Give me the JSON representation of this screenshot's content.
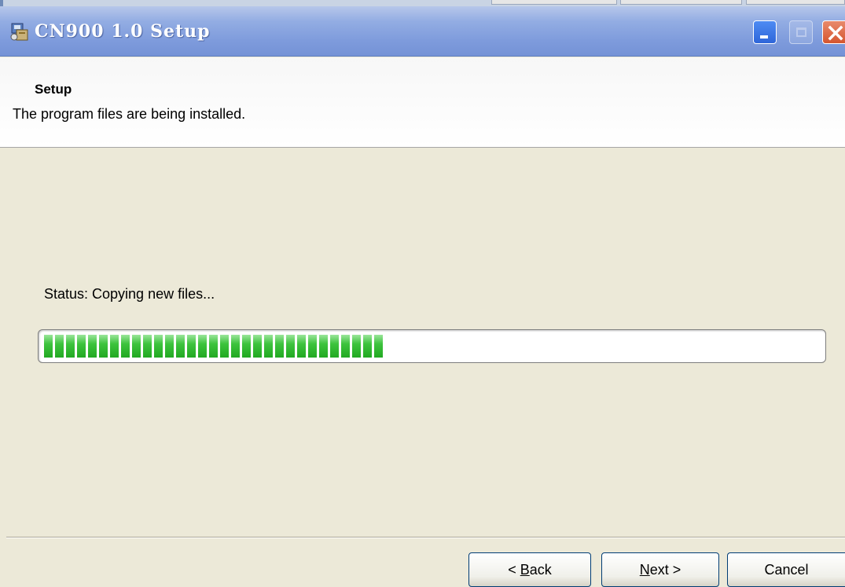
{
  "window": {
    "title": "CN900 1.0 Setup",
    "icon": "installer-icon",
    "controls": [
      "minimize-icon",
      "maximize-icon",
      "close-icon"
    ]
  },
  "header": {
    "title": "Setup",
    "subtitle": "The program files are being installed."
  },
  "main": {
    "status_label": "Status: Copying new files...",
    "progress_fraction": 0.45
  },
  "buttons": {
    "back_label": "< Back",
    "next_label": "Next >",
    "cancel_label": "Cancel"
  },
  "colors": {
    "titlebar": "#7E9BDC",
    "progress_green": "#3DC33D",
    "dialog_bg": "#ECE9D8",
    "close_red": "#D5552F"
  }
}
